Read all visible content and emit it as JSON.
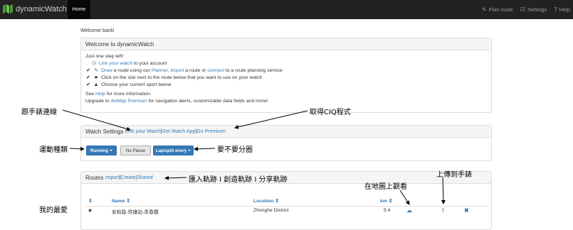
{
  "navbar": {
    "brand": "dynamicWatch",
    "home": "Home",
    "plan_route": "Plan route",
    "settings": "Settings",
    "help": "Help"
  },
  "welcome_back": "Welcome back!",
  "welcome_panel": {
    "title": "Welcome to dynamicWatch",
    "intro": "Just one step left!",
    "step1_link": "Link your watch",
    "step1_rest": " to your account",
    "step2_a": "Draw",
    "step2_b": " a route using our ",
    "step2_c": "Planner",
    "step2_d": ", ",
    "step2_e": "import",
    "step2_f": " a route or ",
    "step2_g": "connect",
    "step2_h": " to a route planning service",
    "step3": "Click on the star next to the route below that you want to use on your watch",
    "step4": "Choose your current sport below",
    "help_a": "See ",
    "help_b": "Help",
    "help_c": " for more information.",
    "upgrade_a": "Upgrade to ",
    "upgrade_b": "dwMap Premium",
    "upgrade_c": " for navigation alerts, customizable data fields and more!"
  },
  "watch_settings": {
    "title": "Watch Settings",
    "link_watch": "Link your Watch",
    "sep1": " | ",
    "get_app": "Get Watch App",
    "sep2": " | ",
    "go_premium": "Go Premium!",
    "sport_button": "Running",
    "pause_button": "No Pause",
    "lap_button": "Lap/split every"
  },
  "routes": {
    "title": "Routes",
    "import": "Import",
    "sep1": " | ",
    "create": "Create",
    "sep2": " | ",
    "shared": "Shared",
    "col_sort": "⇕",
    "col_name": "Name ⇕",
    "col_location": "Location ⇕",
    "col_km": "km ⇕",
    "row": {
      "star": "★",
      "name": "安和路-供撞站-青春橋",
      "location": "Zhonghe District",
      "km": "5.4"
    }
  },
  "annotations": {
    "link_watch": "跟手錶連線",
    "ciq": "取得CIQ程式",
    "sport": "運動種類",
    "split": "要不要分圈",
    "import_create_share": "匯入軌跡 I 創造軌跡 I 分享軌跡",
    "view_map": "在地圖上觀看",
    "upload": "上傳到手錶",
    "favorite": "我的最愛"
  }
}
